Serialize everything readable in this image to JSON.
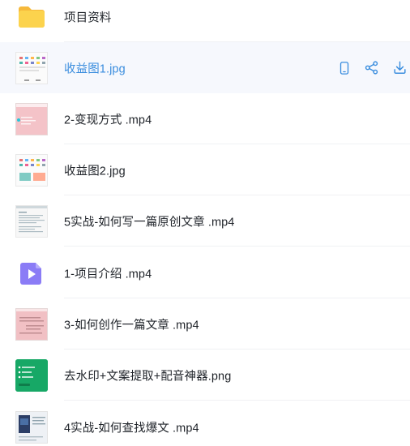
{
  "files": [
    {
      "name": "项目资料",
      "icon": "folder-icon"
    },
    {
      "name": "收益图1.jpg",
      "icon": "image-thumbnail",
      "selected": true
    },
    {
      "name": "2-变现方式 .mp4",
      "icon": "video-thumbnail"
    },
    {
      "name": "收益图2.jpg",
      "icon": "image-thumbnail"
    },
    {
      "name": "5实战-如何写一篇原创文章 .mp4",
      "icon": "video-thumbnail"
    },
    {
      "name": "1-项目介绍 .mp4",
      "icon": "video-file-icon"
    },
    {
      "name": "3-如何创作一篇文章 .mp4",
      "icon": "video-thumbnail"
    },
    {
      "name": "去水印+文案提取+配音神器.png",
      "icon": "image-thumbnail"
    },
    {
      "name": "4实战-如何查找爆文 .mp4",
      "icon": "video-thumbnail"
    }
  ],
  "row_actions": {
    "phone": "phone-icon",
    "share": "share-icon",
    "download": "download-icon"
  },
  "colors": {
    "accent": "#3a8dde",
    "selected_bg": "#f6f8fd",
    "folder": "#f7c948",
    "video_icon": "#8b7cf6",
    "text": "#1f2329"
  }
}
